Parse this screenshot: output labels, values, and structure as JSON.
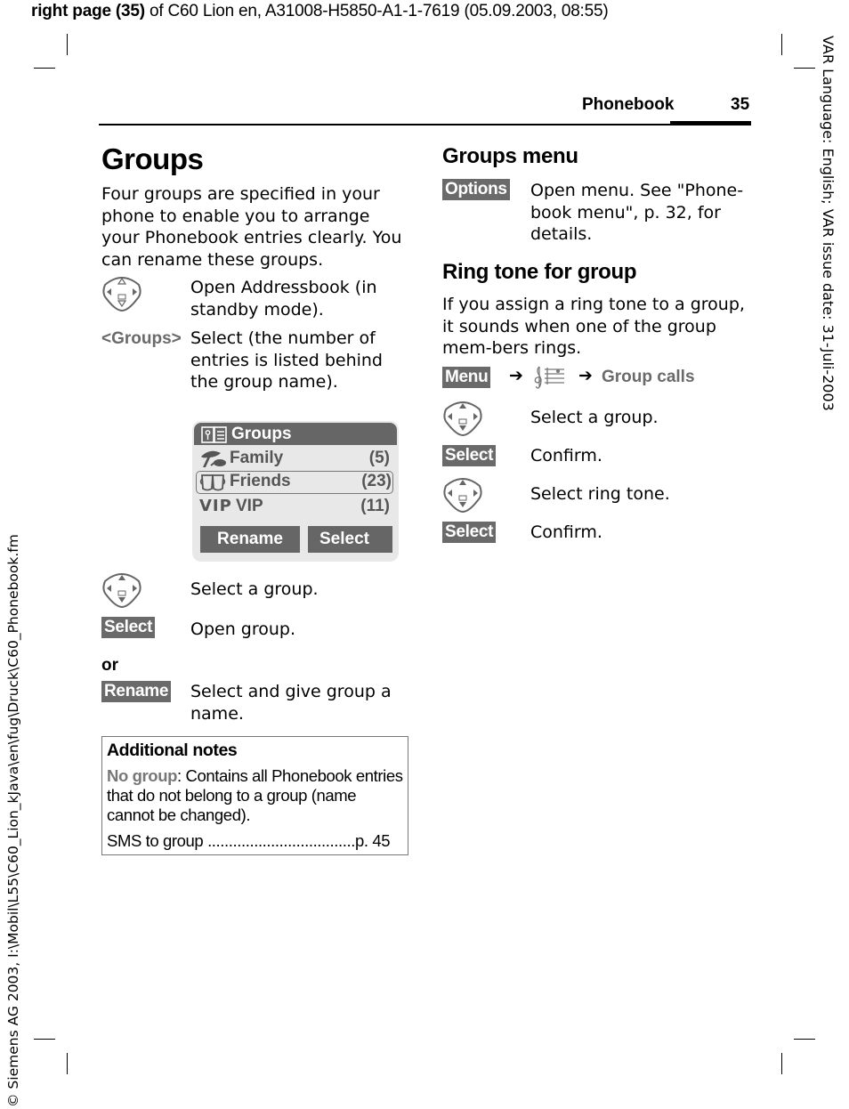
{
  "print_header": {
    "bold_part": "right page (35)",
    "rest": " of C60 Lion en, A31008-H5850-A1-1-7619 (05.09.2003, 08:55)"
  },
  "side_right_text": "VAR Language: English; VAR issue date: 31-Juli-2003",
  "side_left_text": "© Siemens AG 2003, I:\\Mobil\\L55\\C60_Lion_kJava\\en\\fug\\Druck\\C60_Phonebook.fm",
  "running_header": {
    "section": "Phonebook",
    "page": "35"
  },
  "left_column": {
    "title": "Groups",
    "intro": "Four groups are specified in your phone to enable you to arrange your Phonebook entries clearly. You can rename these groups.",
    "steps": [
      {
        "icon": "navigation-key-icon",
        "text": "Open Addressbook (in standby mode)."
      },
      {
        "label": "<Groups>",
        "text": "Select (the number of entries is listed behind the group name)."
      }
    ],
    "phone_screen": {
      "title": "Groups",
      "title_icon": "phonebook-icon",
      "rows": [
        {
          "icon": "family-icon",
          "name": "Family",
          "count": "(5)",
          "selected": false
        },
        {
          "icon": "friends-icon",
          "name": "Friends",
          "count": "(23)",
          "selected": true
        },
        {
          "icon": "vip-icon",
          "icon_text": "VIP",
          "name": "VIP",
          "count": "(11)",
          "selected": false
        }
      ],
      "softkeys": {
        "left": "Rename",
        "right": "Select"
      }
    },
    "steps2": [
      {
        "icon": "navigation-key-icon",
        "text": "Select a group."
      },
      {
        "key": "Select",
        "text": "Open group."
      }
    ],
    "or_label": "or",
    "steps3": [
      {
        "key": "Rename",
        "text": "Select and give group a name."
      }
    ],
    "notes": {
      "title": "Additional notes",
      "term": "No group",
      "text": ": Contains all Phonebook entries that do not belong to a group (name cannot be changed).",
      "ref_label": "SMS to group",
      "ref_dots": " ...................................",
      "ref_page": "p. 45"
    }
  },
  "right_column": {
    "groups_menu": {
      "title": "Groups menu",
      "key": "Options",
      "text": "Open menu. See \"Phone-book menu\", p. 32, for details."
    },
    "ring_tone": {
      "title": "Ring tone for group",
      "intro": "If you assign a ring tone to a group, it sounds when one of the group mem-bers rings.",
      "path": {
        "key": "Menu",
        "arrow": "➔",
        "icon": "music-note-icon",
        "target": "Group calls"
      },
      "steps": [
        {
          "icon": "navigation-key-icon",
          "text": "Select a group."
        },
        {
          "key": "Select",
          "text": "Confirm."
        },
        {
          "icon": "navigation-key-icon",
          "text": "Select ring tone."
        },
        {
          "key": "Select",
          "text": "Confirm."
        }
      ]
    }
  },
  "colors": {
    "key_bg": "#6a6a6a",
    "screen_bg": "#e8e8e8",
    "screen_bar": "#666666"
  }
}
